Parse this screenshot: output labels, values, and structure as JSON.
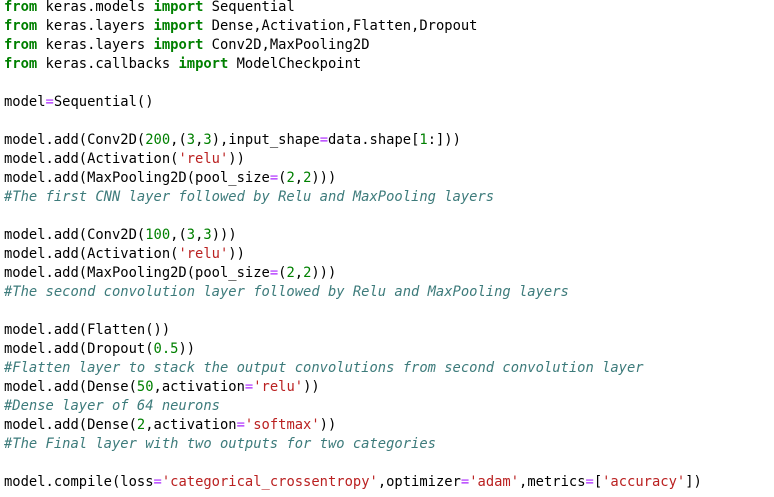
{
  "code": {
    "lines": [
      [
        {
          "t": "kw",
          "v": "from"
        },
        {
          "t": "tx",
          "v": " keras.models "
        },
        {
          "t": "kw",
          "v": "import"
        },
        {
          "t": "tx",
          "v": " Sequential"
        }
      ],
      [
        {
          "t": "kw",
          "v": "from"
        },
        {
          "t": "tx",
          "v": " keras.layers "
        },
        {
          "t": "kw",
          "v": "import"
        },
        {
          "t": "tx",
          "v": " Dense,Activation,Flatten,Dropout"
        }
      ],
      [
        {
          "t": "kw",
          "v": "from"
        },
        {
          "t": "tx",
          "v": " keras.layers "
        },
        {
          "t": "kw",
          "v": "import"
        },
        {
          "t": "tx",
          "v": " Conv2D,MaxPooling2D"
        }
      ],
      [
        {
          "t": "kw",
          "v": "from"
        },
        {
          "t": "tx",
          "v": " keras.callbacks "
        },
        {
          "t": "kw",
          "v": "import"
        },
        {
          "t": "tx",
          "v": " ModelCheckpoint"
        }
      ],
      [],
      [
        {
          "t": "tx",
          "v": "model"
        },
        {
          "t": "op",
          "v": "="
        },
        {
          "t": "tx",
          "v": "Sequential()"
        }
      ],
      [],
      [
        {
          "t": "tx",
          "v": "model.add(Conv2D("
        },
        {
          "t": "num",
          "v": "200"
        },
        {
          "t": "tx",
          "v": ",("
        },
        {
          "t": "num",
          "v": "3"
        },
        {
          "t": "tx",
          "v": ","
        },
        {
          "t": "num",
          "v": "3"
        },
        {
          "t": "tx",
          "v": "),input_shape"
        },
        {
          "t": "op",
          "v": "="
        },
        {
          "t": "tx",
          "v": "data.shape["
        },
        {
          "t": "num",
          "v": "1"
        },
        {
          "t": "tx",
          "v": ":]))"
        }
      ],
      [
        {
          "t": "tx",
          "v": "model.add(Activation("
        },
        {
          "t": "str",
          "v": "'relu'"
        },
        {
          "t": "tx",
          "v": "))"
        }
      ],
      [
        {
          "t": "tx",
          "v": "model.add(MaxPooling2D(pool_size"
        },
        {
          "t": "op",
          "v": "="
        },
        {
          "t": "tx",
          "v": "("
        },
        {
          "t": "num",
          "v": "2"
        },
        {
          "t": "tx",
          "v": ","
        },
        {
          "t": "num",
          "v": "2"
        },
        {
          "t": "tx",
          "v": ")))"
        }
      ],
      [
        {
          "t": "cm",
          "v": "#The first CNN layer followed by Relu and MaxPooling layers"
        }
      ],
      [],
      [
        {
          "t": "tx",
          "v": "model.add(Conv2D("
        },
        {
          "t": "num",
          "v": "100"
        },
        {
          "t": "tx",
          "v": ",("
        },
        {
          "t": "num",
          "v": "3"
        },
        {
          "t": "tx",
          "v": ","
        },
        {
          "t": "num",
          "v": "3"
        },
        {
          "t": "tx",
          "v": ")))"
        }
      ],
      [
        {
          "t": "tx",
          "v": "model.add(Activation("
        },
        {
          "t": "str",
          "v": "'relu'"
        },
        {
          "t": "tx",
          "v": "))"
        }
      ],
      [
        {
          "t": "tx",
          "v": "model.add(MaxPooling2D(pool_size"
        },
        {
          "t": "op",
          "v": "="
        },
        {
          "t": "tx",
          "v": "("
        },
        {
          "t": "num",
          "v": "2"
        },
        {
          "t": "tx",
          "v": ","
        },
        {
          "t": "num",
          "v": "2"
        },
        {
          "t": "tx",
          "v": ")))"
        }
      ],
      [
        {
          "t": "cm",
          "v": "#The second convolution layer followed by Relu and MaxPooling layers"
        }
      ],
      [],
      [
        {
          "t": "tx",
          "v": "model.add(Flatten())"
        }
      ],
      [
        {
          "t": "tx",
          "v": "model.add(Dropout("
        },
        {
          "t": "num",
          "v": "0.5"
        },
        {
          "t": "tx",
          "v": "))"
        }
      ],
      [
        {
          "t": "cm",
          "v": "#Flatten layer to stack the output convolutions from second convolution layer"
        }
      ],
      [
        {
          "t": "tx",
          "v": "model.add(Dense("
        },
        {
          "t": "num",
          "v": "50"
        },
        {
          "t": "tx",
          "v": ",activation"
        },
        {
          "t": "op",
          "v": "="
        },
        {
          "t": "str",
          "v": "'relu'"
        },
        {
          "t": "tx",
          "v": "))"
        }
      ],
      [
        {
          "t": "cm",
          "v": "#Dense layer of 64 neurons"
        }
      ],
      [
        {
          "t": "tx",
          "v": "model.add(Dense("
        },
        {
          "t": "num",
          "v": "2"
        },
        {
          "t": "tx",
          "v": ",activation"
        },
        {
          "t": "op",
          "v": "="
        },
        {
          "t": "str",
          "v": "'softmax'"
        },
        {
          "t": "tx",
          "v": "))"
        }
      ],
      [
        {
          "t": "cm",
          "v": "#The Final layer with two outputs for two categories"
        }
      ],
      [],
      [
        {
          "t": "tx",
          "v": "model.compile(loss"
        },
        {
          "t": "op",
          "v": "="
        },
        {
          "t": "str",
          "v": "'categorical_crossentropy'"
        },
        {
          "t": "tx",
          "v": ",optimizer"
        },
        {
          "t": "op",
          "v": "="
        },
        {
          "t": "str",
          "v": "'adam'"
        },
        {
          "t": "tx",
          "v": ",metrics"
        },
        {
          "t": "op",
          "v": "="
        },
        {
          "t": "tx",
          "v": "["
        },
        {
          "t": "str",
          "v": "'accuracy'"
        },
        {
          "t": "tx",
          "v": "])"
        }
      ]
    ]
  },
  "colors": {
    "keyword": "#008000",
    "operator": "#aa22ff",
    "number": "#008000",
    "string": "#ba2121",
    "comment": "#3d7b7b",
    "text": "#000000",
    "background": "#ffffff"
  }
}
